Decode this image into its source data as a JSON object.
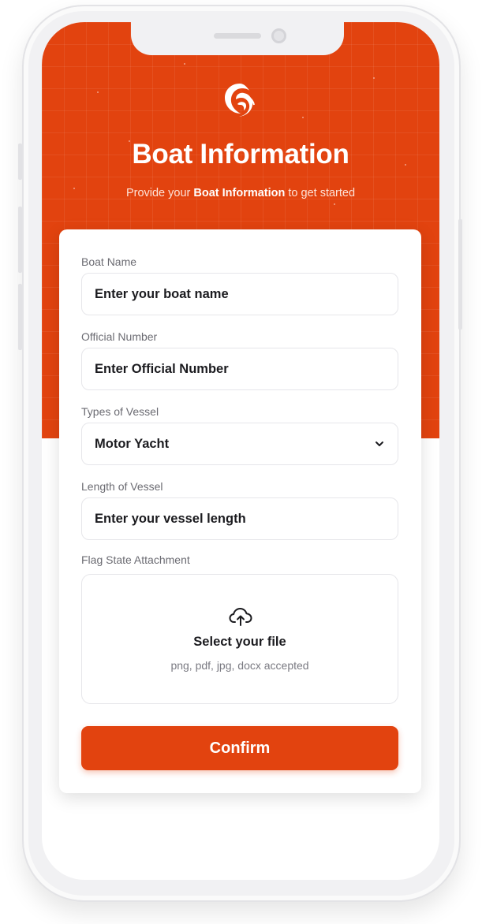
{
  "header": {
    "title": "Boat Information",
    "subtitle_prefix": "Provide your ",
    "subtitle_bold": "Boat Information",
    "subtitle_suffix": " to get started",
    "accent_color": "#e2430f",
    "logo_icon": "swirl-logo-icon"
  },
  "form": {
    "boat_name": {
      "label": "Boat Name",
      "placeholder": "Enter your boat name"
    },
    "official_number": {
      "label": "Official Number",
      "placeholder": "Enter Official Number"
    },
    "vessel_type": {
      "label": "Types of Vessel",
      "value": "Motor Yacht",
      "icon": "chevron-down-icon"
    },
    "vessel_length": {
      "label": "Length of Vessel",
      "placeholder": "Enter your vessel length"
    },
    "attachment": {
      "label": "Flag State Attachment",
      "title": "Select your file",
      "hint": "png, pdf, jpg, docx accepted",
      "icon": "cloud-upload-icon"
    },
    "confirm_label": "Confirm"
  }
}
